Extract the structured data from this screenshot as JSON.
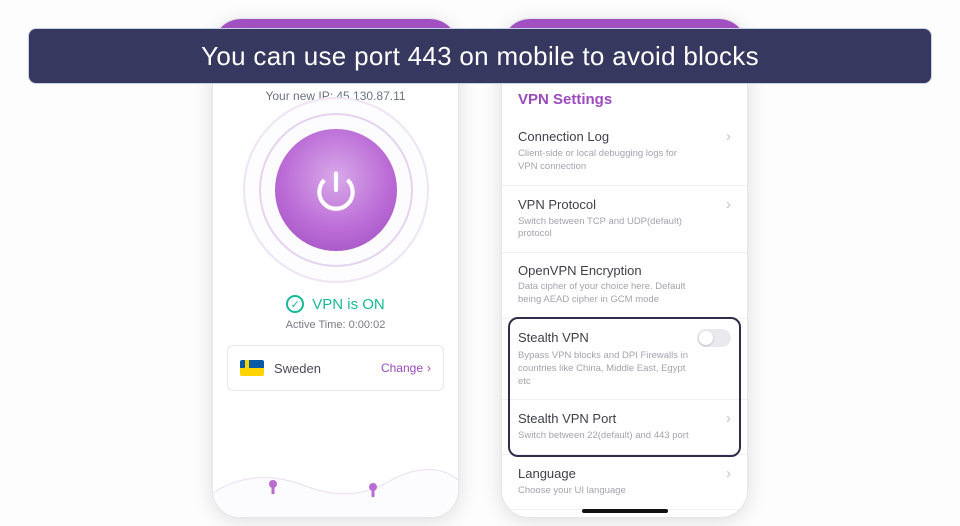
{
  "banner": {
    "text": "You can use port 443 on mobile to avoid blocks"
  },
  "left": {
    "ipLabel": "Your new IP: 45.130.87.11",
    "status": "VPN is ON",
    "activeTime": "Active Time: 0:00:02",
    "server": "Sweden",
    "changeLabel": "Change"
  },
  "right": {
    "title": "VPN Settings",
    "items": [
      {
        "title": "Connection Log",
        "sub": "Client-side or local debugging logs for VPN connection",
        "control": "chevron"
      },
      {
        "title": "VPN Protocol",
        "sub": "Switch between TCP and UDP(default) protocol",
        "control": "chevron"
      },
      {
        "title": "OpenVPN Encryption",
        "sub": "Data cipher of your choice here. Default being AEAD cipher in GCM mode",
        "control": "none"
      },
      {
        "title": "Stealth VPN",
        "sub": "Bypass VPN blocks and DPI Firewalls in countries like China, Middle East, Egypt etc",
        "control": "toggle"
      },
      {
        "title": "Stealth VPN Port",
        "sub": "Switch between 22(default) and 443 port",
        "control": "chevron"
      },
      {
        "title": "Language",
        "sub": "Choose your UI language",
        "control": "chevron"
      }
    ]
  }
}
